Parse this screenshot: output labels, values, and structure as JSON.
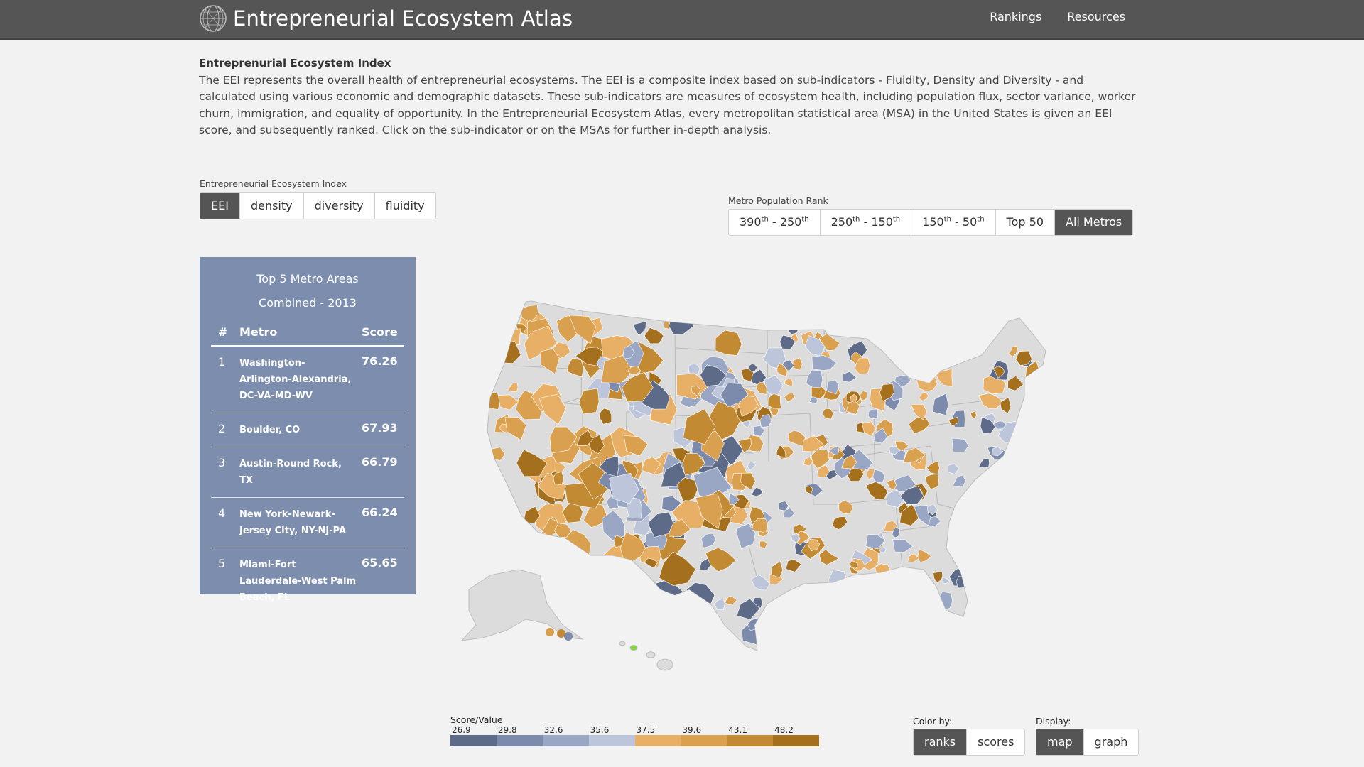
{
  "header": {
    "title": "Entrepreneurial Ecosystem Atlas",
    "nav": [
      "Rankings",
      "Resources"
    ]
  },
  "intro": {
    "heading": "Entreprenurial Ecosystem Index",
    "body": "The EEI represents the overall health of entrepreneurial ecosystems. The EEI is a composite index based on sub-indicators - Fluidity, Density and Diversity - and calculated using various economic and demographic datasets. These sub-indicators are measures of ecosystem health, including population flux, sector variance, worker churn, immigration, and equality of opportunity. In the Entrepreneurial Ecosystem Atlas, every metropolitan statistical area (MSA) in the United States is given an EEI score, and subsequently ranked. Click on the sub-indicator or on the MSAs for further in-depth analysis."
  },
  "indicator": {
    "label": "Entrepreneurial Ecosystem Index",
    "options": [
      "EEI",
      "density",
      "diversity",
      "fluidity"
    ],
    "selected": "EEI"
  },
  "population": {
    "label": "Metro Population Rank",
    "options": [
      {
        "a": "390",
        "as": "th",
        "sep": " - ",
        "b": "250",
        "bs": "th"
      },
      {
        "a": "250",
        "as": "th",
        "sep": " - ",
        "b": "150",
        "bs": "th"
      },
      {
        "a": "150",
        "as": "th",
        "sep": " - ",
        "b": "50",
        "bs": "th"
      },
      {
        "text": "Top 50"
      },
      {
        "text": "All Metros"
      }
    ],
    "selected": "All Metros"
  },
  "top5": {
    "title": "Top 5 Metro Areas",
    "subtitle": "Combined - 2013",
    "headers": {
      "num": "#",
      "metro": "Metro",
      "score": "Score"
    },
    "rows": [
      {
        "num": "1",
        "metro": "Washington-Arlington-Alexandria, DC-VA-MD-WV",
        "score": "76.26"
      },
      {
        "num": "2",
        "metro": "Boulder, CO",
        "score": "67.93"
      },
      {
        "num": "3",
        "metro": "Austin-Round Rock, TX",
        "score": "66.79"
      },
      {
        "num": "4",
        "metro": "New York-Newark-Jersey City, NY-NJ-PA",
        "score": "66.24"
      },
      {
        "num": "5",
        "metro": "Miami-Fort Lauderdale-West Palm Beach, FL",
        "score": "65.65"
      }
    ]
  },
  "legend": {
    "title": "Score/Value",
    "ticks": [
      "26.9",
      "29.8",
      "32.6",
      "35.6",
      "37.5",
      "39.6",
      "43.1",
      "48.2"
    ],
    "colors": [
      "#5d6a88",
      "#7c8bab",
      "#9aa7c4",
      "#bcc5da",
      "#e7b066",
      "#d8a04f",
      "#c28a32",
      "#a4701d"
    ]
  },
  "color_by": {
    "label": "Color by:",
    "options": [
      "ranks",
      "scores"
    ],
    "selected": "ranks"
  },
  "display": {
    "label": "Display:",
    "options": [
      "map",
      "graph"
    ],
    "selected": "map"
  },
  "map_colors": {
    "base": "#dcdcdc",
    "border": "#ffffff",
    "highlight": "#7fd833"
  }
}
